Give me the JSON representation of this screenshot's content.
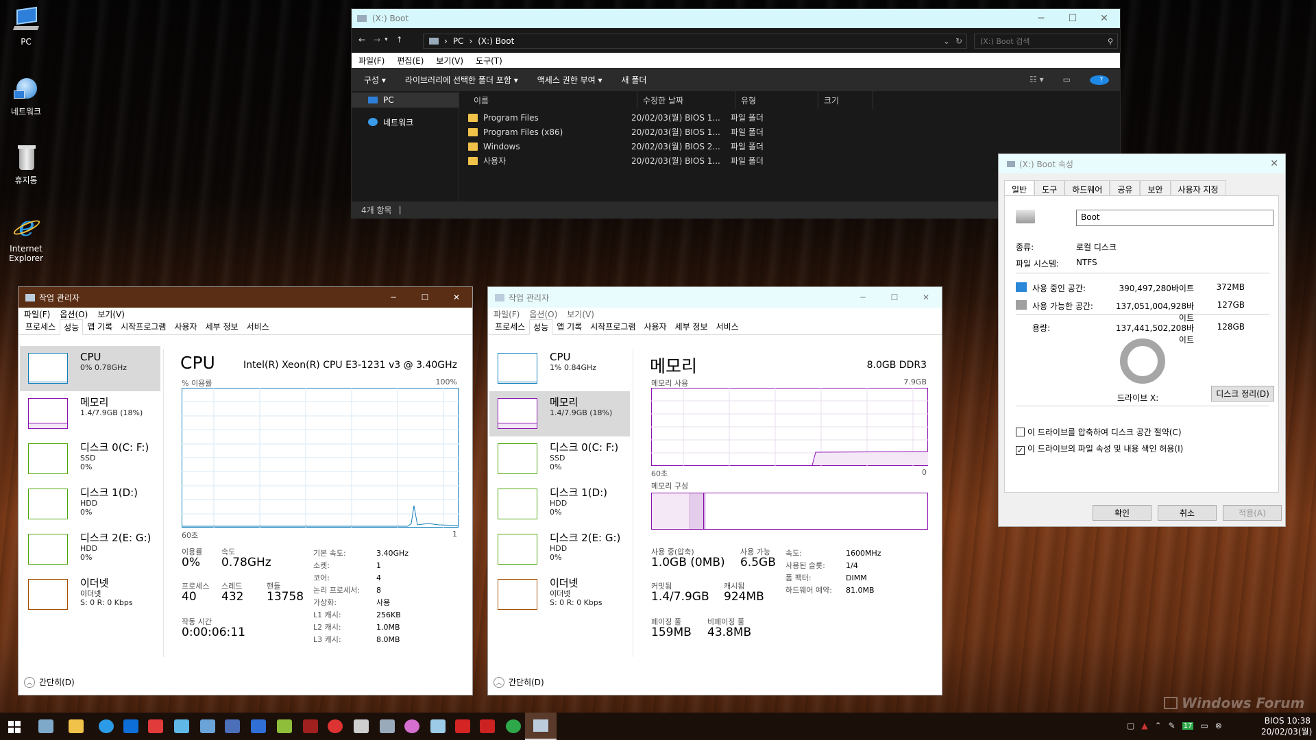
{
  "desktop": {
    "icons": [
      {
        "label": "PC"
      },
      {
        "label": "네트워크"
      },
      {
        "label": "휴지통"
      },
      {
        "label": "Internet Explorer"
      }
    ],
    "watermark": "Windows Forum"
  },
  "explorer": {
    "title": "(X:) Boot",
    "breadcrumb": [
      "PC",
      "(X:) Boot"
    ],
    "search_placeholder": "(X:) Boot 검색",
    "menu": [
      "파일(F)",
      "편집(E)",
      "보기(V)",
      "도구(T)"
    ],
    "commands": [
      "구성 ▾",
      "라이브러리에 선택한 폴더 포함 ▾",
      "액세스 권한 부여 ▾",
      "새 폴더"
    ],
    "nav": [
      "PC",
      "네트워크"
    ],
    "columns": [
      "이름",
      "수정한 날짜",
      "유형",
      "크기"
    ],
    "files": [
      {
        "name": "Program Files",
        "date": "20/02/03(월) BIOS 1...",
        "type": "파일 폴더"
      },
      {
        "name": "Program Files (x86)",
        "date": "20/02/03(월) BIOS 1...",
        "type": "파일 폴더"
      },
      {
        "name": "Windows",
        "date": "20/02/03(월) BIOS 2...",
        "type": "파일 폴더"
      },
      {
        "name": "사용자",
        "date": "20/02/03(월) BIOS 1...",
        "type": "파일 폴더"
      }
    ],
    "status": "4개 항목"
  },
  "properties": {
    "title": "(X:) Boot 속성",
    "tabs": [
      "일반",
      "도구",
      "하드웨어",
      "공유",
      "보안",
      "사용자 지정"
    ],
    "volume_name": "Boot",
    "type_label": "종류:",
    "type_value": "로컬 디스크",
    "fs_label": "파일 시스템:",
    "fs_value": "NTFS",
    "used_label": "사용 중인 공간:",
    "used_bytes": "390,497,280바이트",
    "used_size": "372MB",
    "free_label": "사용 가능한 공간:",
    "free_bytes": "137,051,004,928바이트",
    "free_size": "127GB",
    "capacity_label": "용량:",
    "capacity_bytes": "137,441,502,208바이트",
    "capacity_size": "128GB",
    "drive_label": "드라이브 X:",
    "cleanup_button": "디스크 정리(D)",
    "compress_label": "이 드라이브를 압축하여 디스크 공간 절약(C)",
    "index_label": "이 드라이브의 파일 속성 및 내용 색인 허용(I)",
    "ok": "확인",
    "cancel": "취소",
    "apply": "적용(A)",
    "used_color": "#2b88d8",
    "free_color": "#a0a0a0"
  },
  "tm_common": {
    "title": "작업 관리자",
    "menu": [
      "파일(F)",
      "옵션(O)",
      "보기(V)"
    ],
    "tabs": [
      "프로세스",
      "성능",
      "앱 기록",
      "시작프로그램",
      "사용자",
      "세부 정보",
      "서비스"
    ],
    "footer": "간단히(D)",
    "side": [
      {
        "name": "CPU",
        "sub1": "0% 0.78GHz",
        "sub2": "",
        "color": "#117dbb"
      },
      {
        "name": "메모리",
        "sub1": "1.4/7.9GB (18%)",
        "sub2": "",
        "color": "#8b12ae"
      },
      {
        "name": "디스크 0(C: F:)",
        "sub1": "SSD",
        "sub2": "0%",
        "color": "#4da60c"
      },
      {
        "name": "디스크 1(D:)",
        "sub1": "HDD",
        "sub2": "0%",
        "color": "#4da60c"
      },
      {
        "name": "디스크 2(E: G:)",
        "sub1": "HDD",
        "sub2": "0%",
        "color": "#4da60c"
      },
      {
        "name": "이더넷",
        "sub1": "이더넷",
        "sub2": "S: 0 R: 0 Kbps",
        "color": "#a74f01"
      }
    ],
    "cpu2_sub1": "1% 0.84GHz"
  },
  "tm_cpu": {
    "heading": "CPU",
    "model": "Intel(R) Xeon(R) CPU E3-1231 v3 @ 3.40GHz",
    "graph_label": "% 이용률",
    "graph_max": "100%",
    "graph_time": "60초",
    "graph_min": "1",
    "util_label": "이용률",
    "util": "0%",
    "speed_label": "속도",
    "speed": "0.78GHz",
    "proc_label": "프로세스",
    "proc": "40",
    "thread_label": "스레드",
    "thread": "432",
    "handle_label": "핸들",
    "handle": "13758",
    "uptime_label": "작동 시간",
    "uptime": "0:00:06:11",
    "specs": [
      {
        "k": "기본 속도:",
        "v": "3.40GHz"
      },
      {
        "k": "소켓:",
        "v": "1"
      },
      {
        "k": "코어:",
        "v": "4"
      },
      {
        "k": "논리 프로세서:",
        "v": "8"
      },
      {
        "k": "가상화:",
        "v": "사용"
      },
      {
        "k": "L1 캐시:",
        "v": "256KB"
      },
      {
        "k": "L2 캐시:",
        "v": "1.0MB"
      },
      {
        "k": "L3 캐시:",
        "v": "8.0MB"
      }
    ]
  },
  "tm_mem": {
    "heading": "메모리",
    "total": "8.0GB DDR3",
    "usage_label": "메모리 사용",
    "usage_max": "7.9GB",
    "graph_time": "60초",
    "graph_min": "0",
    "comp_label": "메모리 구성",
    "inuse_label": "사용 중(압축)",
    "inuse": "1.0GB (0MB)",
    "avail_label": "사용 가능",
    "avail": "6.5GB",
    "commit_label": "커밋됨",
    "commit": "1.4/7.9GB",
    "cached_label": "캐시됨",
    "cached": "924MB",
    "paged_label": "페이징 풀",
    "paged": "159MB",
    "nonpaged_label": "비페이징 풀",
    "nonpaged": "43.8MB",
    "specs": [
      {
        "k": "속도:",
        "v": "1600MHz"
      },
      {
        "k": "사용된 슬롯:",
        "v": "1/4"
      },
      {
        "k": "폼 팩터:",
        "v": "DIMM"
      },
      {
        "k": "하드웨어 예약:",
        "v": "81.0MB"
      }
    ]
  },
  "tray": {
    "battery_num": "17",
    "time_label": "BIOS",
    "time": "10:38",
    "date": "20/02/03(월)"
  }
}
